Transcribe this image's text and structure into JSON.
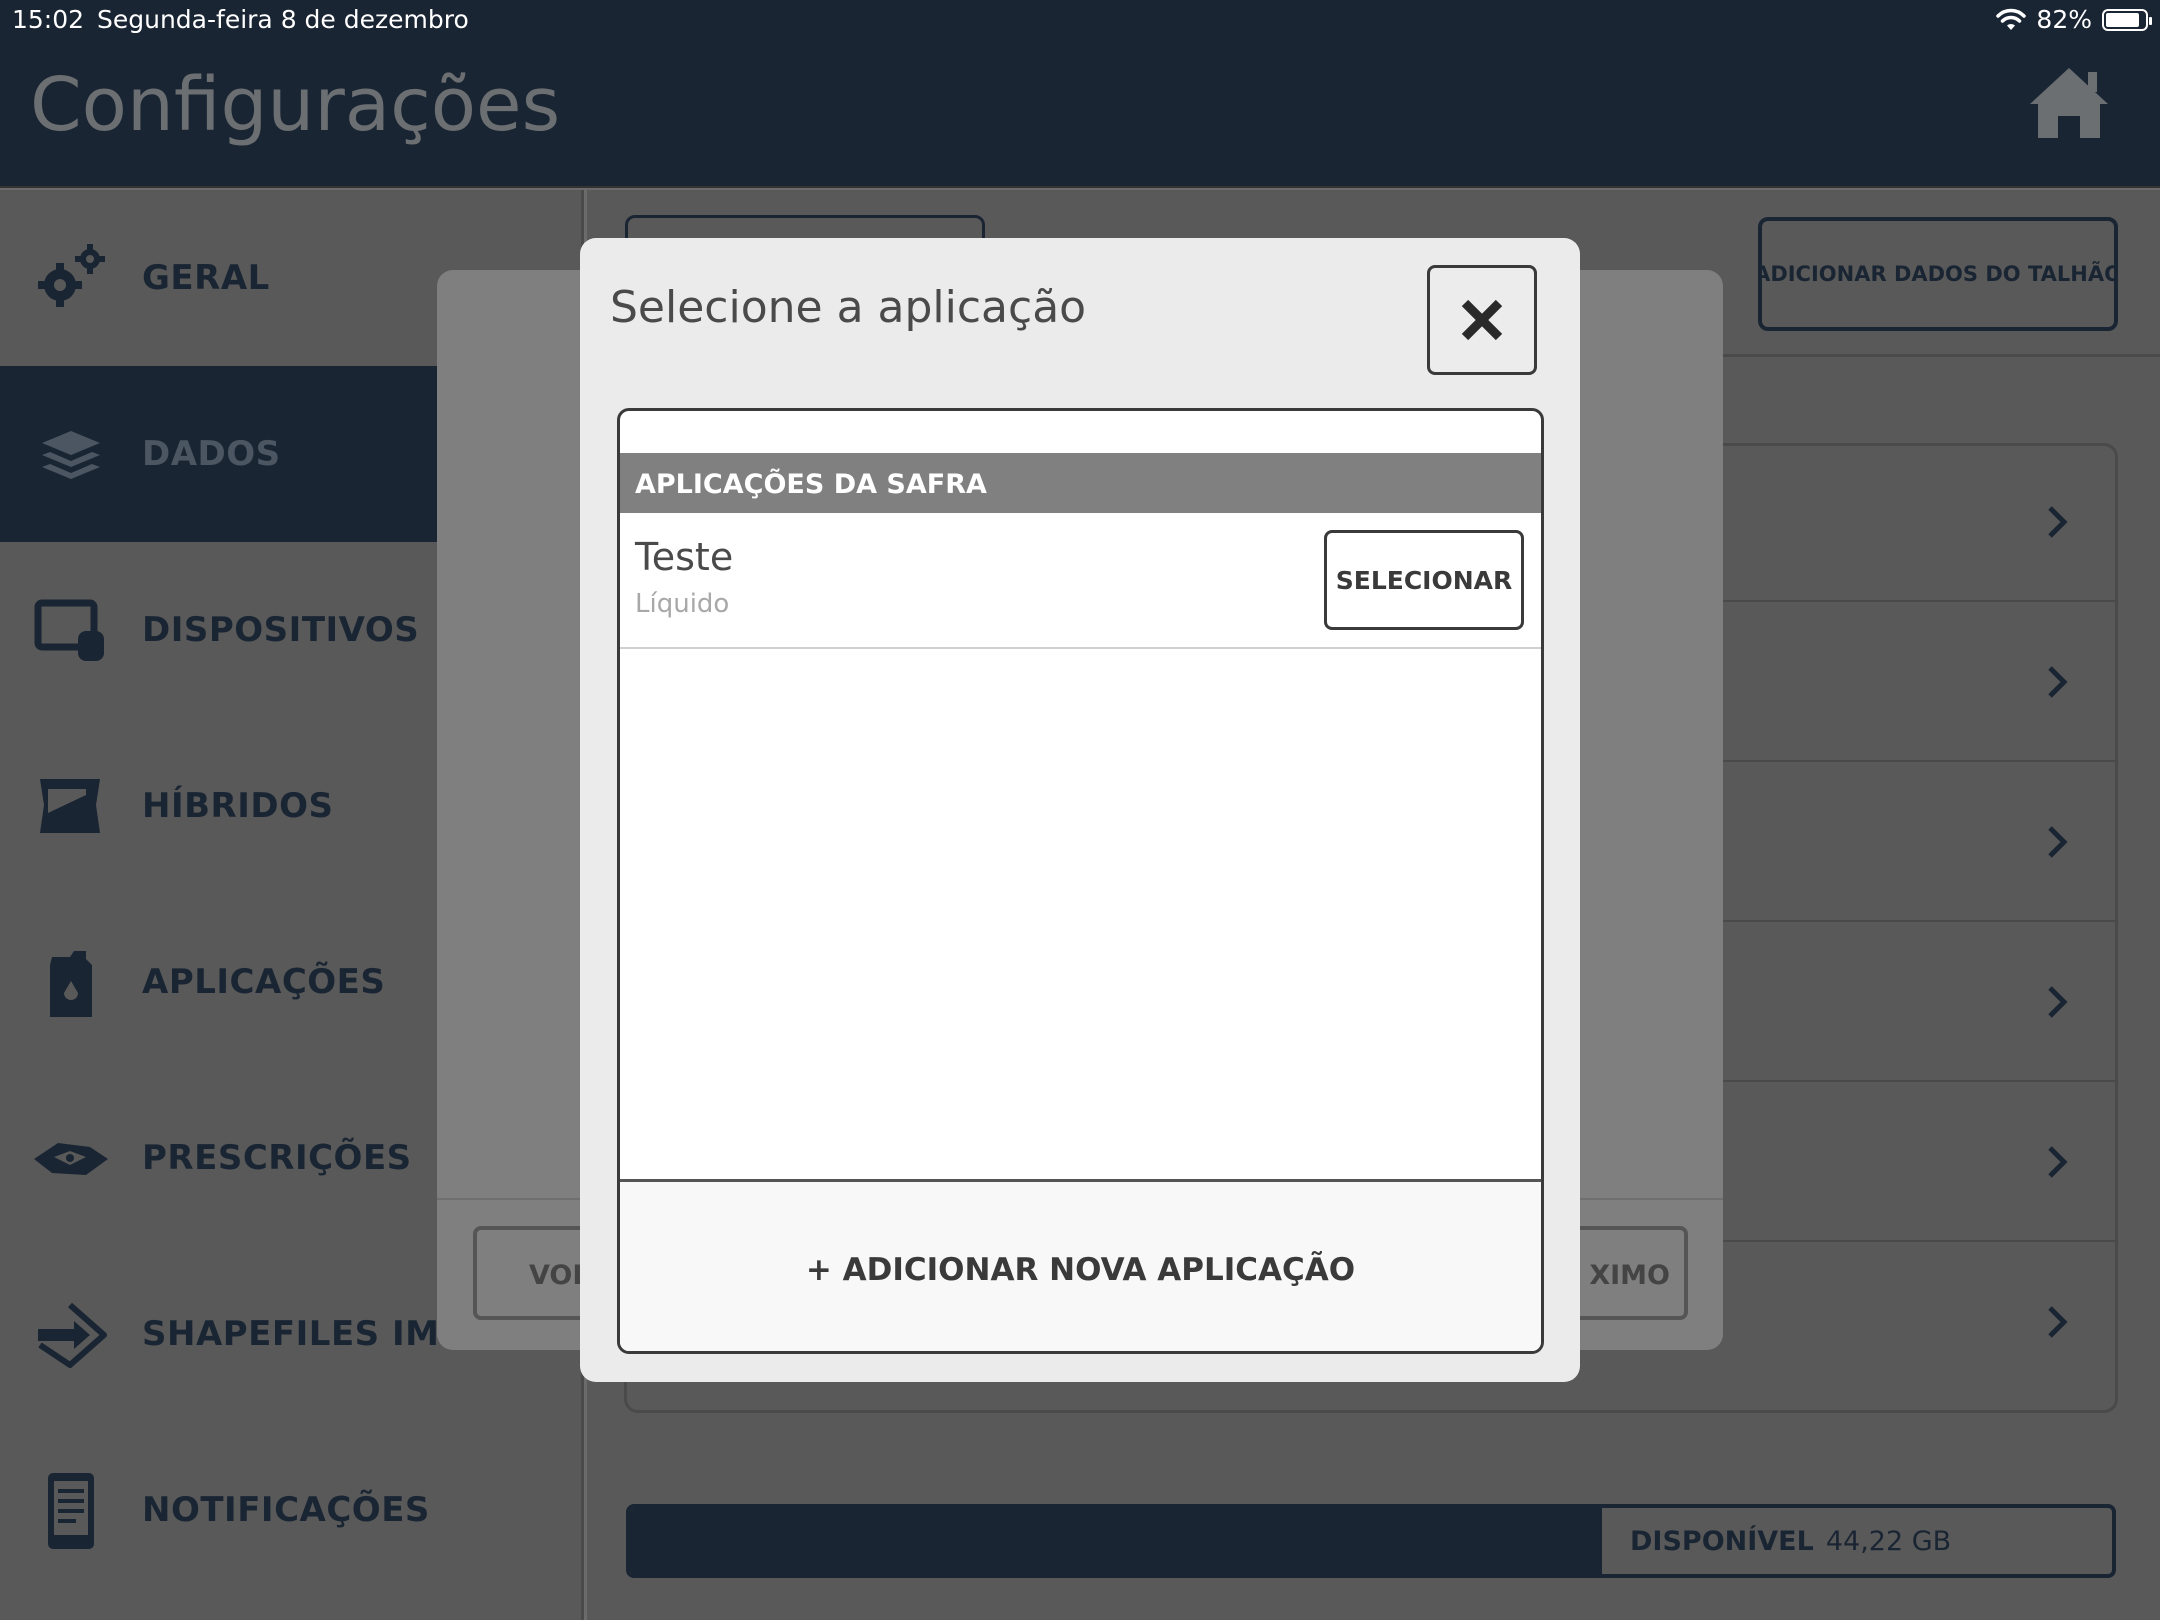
{
  "status": {
    "time": "15:02",
    "date": "Segunda-feira 8 de dezembro",
    "battery": "82%"
  },
  "header": {
    "title": "Configurações"
  },
  "sidebar": {
    "items": [
      {
        "label": "GERAL"
      },
      {
        "label": "DADOS"
      },
      {
        "label": "DISPOSITIVOS"
      },
      {
        "label": "HÍBRIDOS"
      },
      {
        "label": "APLICAÇÕES"
      },
      {
        "label": "PRESCRIÇÕES"
      },
      {
        "label": "SHAPEFILES IMPOR"
      },
      {
        "label": "NOTIFICAÇÕES"
      }
    ]
  },
  "main": {
    "add_talhao_label": "ADICIONAR DADOS DO TALHÃO",
    "storage": {
      "label": "DISPONÍVEL",
      "value": "44,22 GB"
    }
  },
  "back_modal": {
    "back_label": "VOL",
    "next_label": "XIMO"
  },
  "modal": {
    "title": "Selecione a aplicação",
    "section_header": "APLICAÇÕES DA SAFRA",
    "application": {
      "name": "Teste",
      "type": "Líquido",
      "select_label": "SELECIONAR"
    },
    "add_label": "+ ADICIONAR NOVA APLICAÇÃO"
  }
}
